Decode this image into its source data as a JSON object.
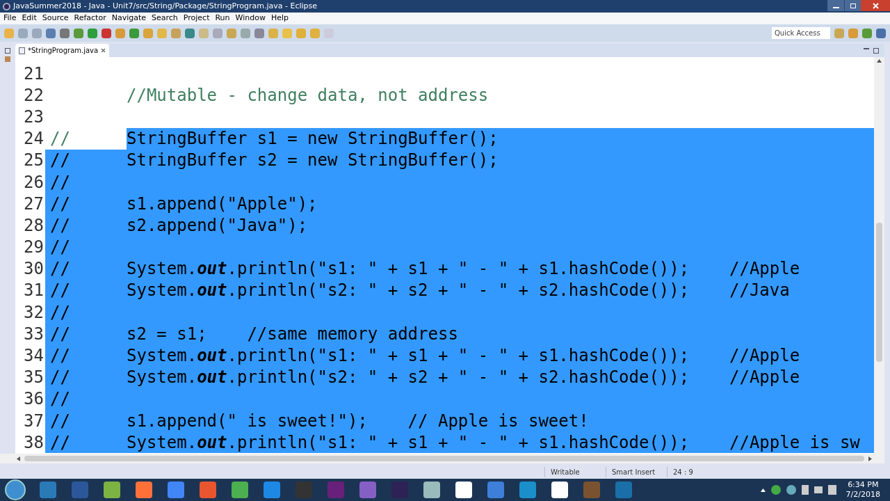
{
  "window": {
    "title": "JavaSummer2018 - Java - Unit7/src/String/Package/StringProgram.java - Eclipse"
  },
  "menu": [
    "File",
    "Edit",
    "Source",
    "Refactor",
    "Navigate",
    "Search",
    "Project",
    "Run",
    "Window",
    "Help"
  ],
  "quick_access": {
    "placeholder": "Quick Access"
  },
  "tabs": [
    {
      "label": "*StringProgram.java",
      "selected": true
    }
  ],
  "editor": {
    "lines": [
      {
        "number": "21"
      },
      {
        "number": "22",
        "selected": false,
        "code": [
          {
            "text": "//Mutable - change data, not address",
            "kind": "comment"
          }
        ]
      },
      {
        "number": "23"
      },
      {
        "number": "24",
        "prefix": {
          "text": "//",
          "selected": false
        },
        "selected": true,
        "code": [
          {
            "text": "StringBuffer s1 = new StringBuffer();",
            "kind": "plain"
          }
        ]
      },
      {
        "number": "25",
        "prefix": {
          "text": "//",
          "selected": true
        },
        "selected": true,
        "code": [
          {
            "text": "StringBuffer s2 = new StringBuffer();",
            "kind": "plain"
          }
        ]
      },
      {
        "number": "26",
        "prefix": {
          "text": "//",
          "selected": true
        },
        "selected": true
      },
      {
        "number": "27",
        "prefix": {
          "text": "//",
          "selected": true
        },
        "selected": true,
        "code": [
          {
            "text": "s1.append(\"Apple\");",
            "kind": "plain"
          }
        ]
      },
      {
        "number": "28",
        "prefix": {
          "text": "//",
          "selected": true
        },
        "selected": true,
        "code": [
          {
            "text": "s2.append(\"Java\");",
            "kind": "plain"
          }
        ]
      },
      {
        "number": "29",
        "prefix": {
          "text": "//",
          "selected": true
        },
        "selected": true
      },
      {
        "number": "30",
        "prefix": {
          "text": "//",
          "selected": true
        },
        "selected": true,
        "code": [
          {
            "text": "System.",
            "kind": "plain"
          },
          {
            "text": "out",
            "kind": "static"
          },
          {
            "text": ".println(\"s1: \" + s1 + \" - \" + s1.hashCode());    //Apple",
            "kind": "plain"
          }
        ]
      },
      {
        "number": "31",
        "prefix": {
          "text": "//",
          "selected": true
        },
        "selected": true,
        "code": [
          {
            "text": "System.",
            "kind": "plain"
          },
          {
            "text": "out",
            "kind": "static"
          },
          {
            "text": ".println(\"s2: \" + s2 + \" - \" + s2.hashCode());    //Java",
            "kind": "plain"
          }
        ]
      },
      {
        "number": "32",
        "prefix": {
          "text": "//",
          "selected": true
        },
        "selected": true
      },
      {
        "number": "33",
        "prefix": {
          "text": "//",
          "selected": true
        },
        "selected": true,
        "code": [
          {
            "text": "s2 = s1;    //same memory address",
            "kind": "plain"
          }
        ]
      },
      {
        "number": "34",
        "prefix": {
          "text": "//",
          "selected": true
        },
        "selected": true,
        "code": [
          {
            "text": "System.",
            "kind": "plain"
          },
          {
            "text": "out",
            "kind": "static"
          },
          {
            "text": ".println(\"s1: \" + s1 + \" - \" + s1.hashCode());    //Apple",
            "kind": "plain"
          }
        ]
      },
      {
        "number": "35",
        "prefix": {
          "text": "//",
          "selected": true
        },
        "selected": true,
        "code": [
          {
            "text": "System.",
            "kind": "plain"
          },
          {
            "text": "out",
            "kind": "static"
          },
          {
            "text": ".println(\"s2: \" + s2 + \" - \" + s2.hashCode());    //Apple",
            "kind": "plain"
          }
        ]
      },
      {
        "number": "36",
        "prefix": {
          "text": "//",
          "selected": true
        },
        "selected": true
      },
      {
        "number": "37",
        "prefix": {
          "text": "//",
          "selected": true
        },
        "selected": true,
        "code": [
          {
            "text": "s1.append(\" is sweet!\");    // Apple is sweet!",
            "kind": "plain"
          }
        ]
      },
      {
        "number": "38",
        "prefix": {
          "text": "//",
          "selected": true
        },
        "selected": true,
        "code": [
          {
            "text": "System.",
            "kind": "plain"
          },
          {
            "text": "out",
            "kind": "static"
          },
          {
            "text": ".println(\"s1: \" + s1 + \" - \" + s1.hashCode());    //Apple is sw",
            "kind": "plain"
          }
        ]
      }
    ]
  },
  "status_bar": [
    "Writable",
    "Smart Insert",
    "24 : 9"
  ],
  "clock": {
    "time": "6:34 PM",
    "date": "7/2/2018"
  }
}
